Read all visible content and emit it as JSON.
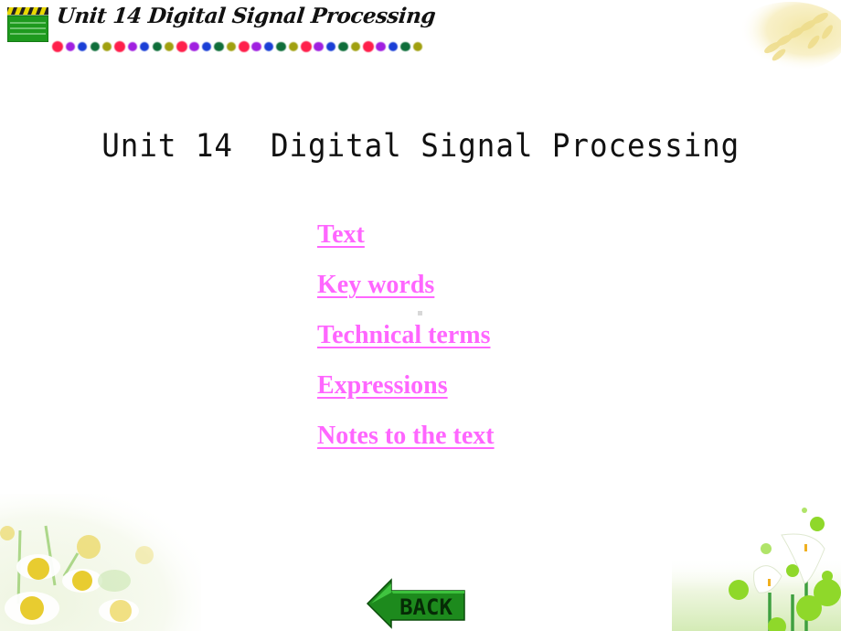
{
  "header": {
    "title": "Unit 14  Digital Signal Processing",
    "icon": "clapperboard-icon",
    "dot_colors": [
      "#ff1f4b",
      "#a020e0",
      "#1a3fd6",
      "#0f6e3a",
      "#a0a010"
    ]
  },
  "main": {
    "title": "Unit 14  Digital Signal Processing"
  },
  "menu": {
    "items": [
      {
        "label": "Text"
      },
      {
        "label": "Key words"
      },
      {
        "label": "Technical terms"
      },
      {
        "label": "Expressions"
      },
      {
        "label": "Notes to the text"
      }
    ],
    "link_color": "#ff66ff"
  },
  "footer": {
    "back_label": "BACK",
    "back_icon": "back-arrow-icon"
  },
  "decorations": {
    "top_right": "wheat-image",
    "bottom_left": "daisies-image",
    "bottom_right": "calla-lilies-image"
  }
}
